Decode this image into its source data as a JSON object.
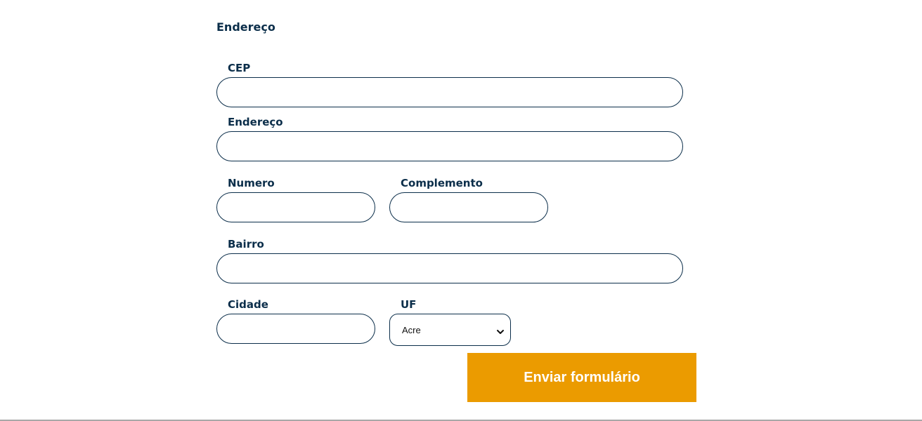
{
  "form": {
    "section_title": "Endereço",
    "fields": {
      "cep": {
        "label": "CEP",
        "value": ""
      },
      "endereco": {
        "label": "Endereço",
        "value": ""
      },
      "numero": {
        "label": "Numero",
        "value": ""
      },
      "complemento": {
        "label": "Complemento",
        "value": ""
      },
      "bairro": {
        "label": "Bairro",
        "value": ""
      },
      "cidade": {
        "label": "Cidade",
        "value": ""
      },
      "uf": {
        "label": "UF",
        "selected": "Acre"
      }
    },
    "submit_label": "Enviar formulário"
  },
  "colors": {
    "text": "#0b2e4a",
    "border": "#0b2e4a",
    "button": "#eb9b00",
    "button_text": "#ffffff"
  },
  "icons": {
    "uf_select": "chevron-down-icon"
  }
}
